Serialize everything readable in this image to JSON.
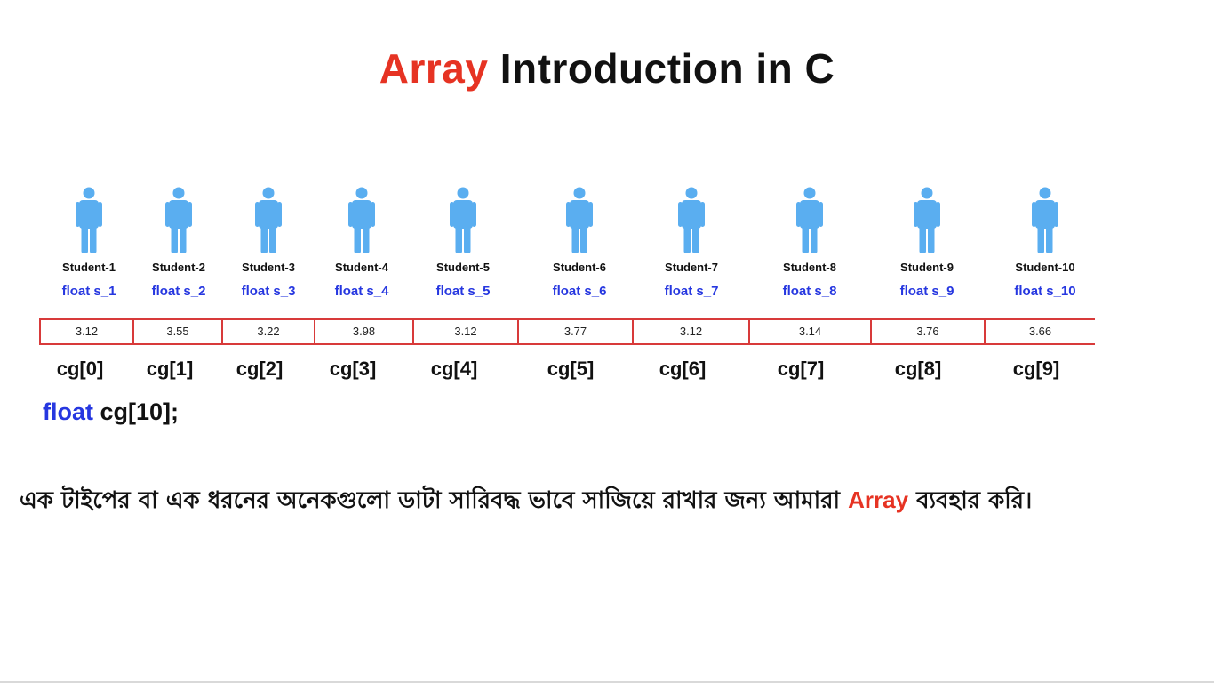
{
  "title": {
    "accent": "Array",
    "rest": "Introduction in C"
  },
  "colors": {
    "accent_red": "#e63323",
    "keyword_blue": "#2637e0",
    "person_blue": "#5aaef0",
    "cell_border": "#d83a3a"
  },
  "students": [
    {
      "name": "Student-1",
      "var": "float s_1",
      "value": "3.12",
      "index": "cg[0]",
      "icon": "person-icon"
    },
    {
      "name": "Student-2",
      "var": "float s_2",
      "value": "3.55",
      "index": "cg[1]",
      "icon": "person-icon"
    },
    {
      "name": "Student-3",
      "var": "float s_3",
      "value": "3.22",
      "index": "cg[2]",
      "icon": "person-icon"
    },
    {
      "name": "Student-4",
      "var": "float s_4",
      "value": "3.98",
      "index": "cg[3]",
      "icon": "person-icon"
    },
    {
      "name": "Student-5",
      "var": "float s_5",
      "value": "3.12",
      "index": "cg[4]",
      "icon": "person-icon"
    },
    {
      "name": "Student-6",
      "var": "float s_6",
      "value": "3.77",
      "index": "cg[5]",
      "icon": "person-icon"
    },
    {
      "name": "Student-7",
      "var": "float s_7",
      "value": "3.12",
      "index": "cg[6]",
      "icon": "person-icon"
    },
    {
      "name": "Student-8",
      "var": "float s_8",
      "value": "3.14",
      "index": "cg[7]",
      "icon": "person-icon"
    },
    {
      "name": "Student-9",
      "var": "float s_9",
      "value": "3.76",
      "index": "cg[8]",
      "icon": "person-icon"
    },
    {
      "name": "Student-10",
      "var": "float s_10",
      "value": "3.66",
      "index": "cg[9]",
      "icon": "person-icon"
    }
  ],
  "declaration": {
    "keyword": "float",
    "rest": " cg[10];"
  },
  "caption": {
    "before": "এক টাইপের বা এক ধরনের অনেকগুলো ডাটা সারিবদ্ধ ভাবে সাজিয়ে রাখার জন্য আমারা ",
    "accent": "Array",
    "after": " ব্যবহার করি।"
  }
}
